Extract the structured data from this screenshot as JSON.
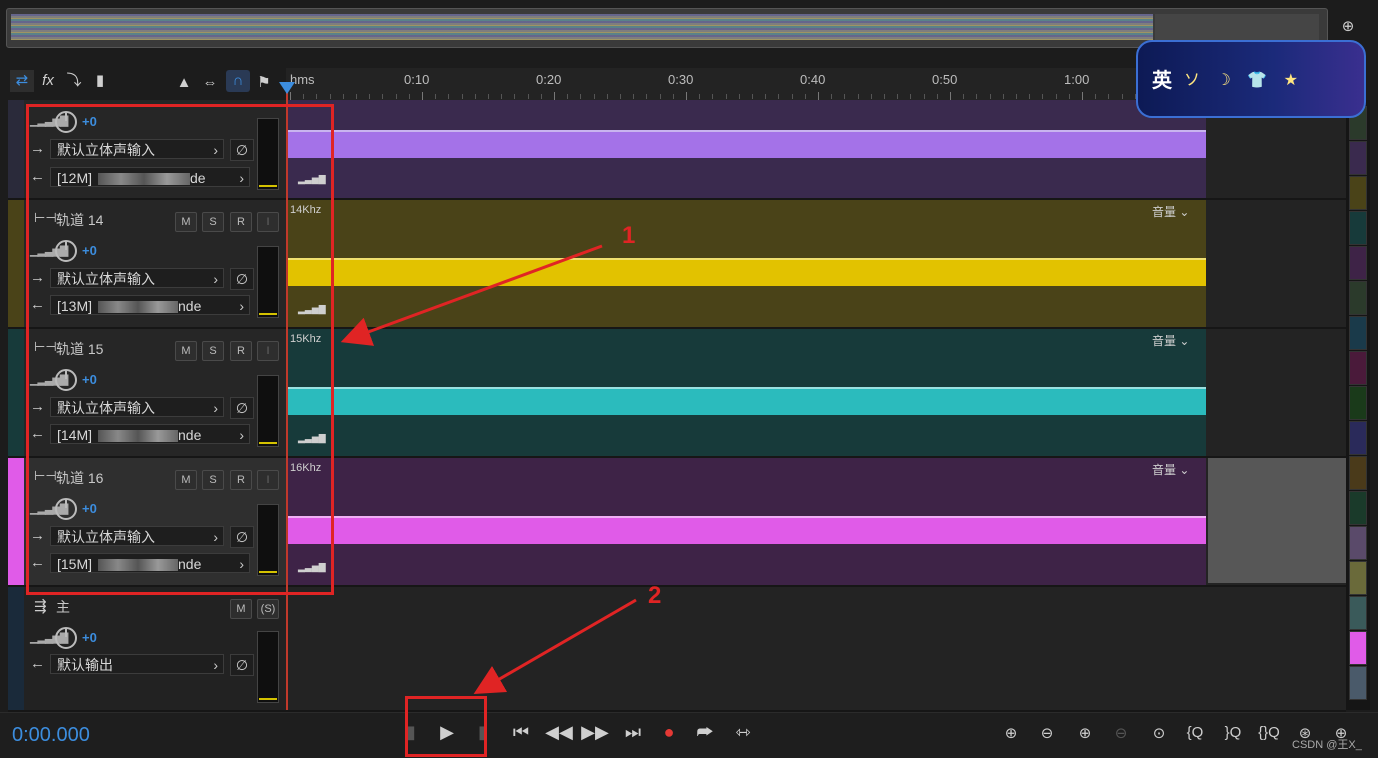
{
  "overview": {},
  "toolbar_left": {
    "icons": [
      "swap-icon",
      "fx-icon",
      "send-icon",
      "eq-bars-icon"
    ],
    "fx_label": "fx"
  },
  "toolbar_mid": {
    "icons": [
      "metronome-icon",
      "punch-icon",
      "snap-magnet-icon",
      "marker-icon"
    ]
  },
  "ruler": {
    "labels": [
      "hms",
      "0:10",
      "0:20",
      "0:30",
      "0:40",
      "0:50",
      "1:00"
    ]
  },
  "tracks": [
    {
      "name": "",
      "volume": "+0",
      "input": "默认立体声输入",
      "output": "[12M]",
      "output_tail": "de",
      "color": "#a472e8",
      "lane_bg": "#3a2a4e",
      "khz": "",
      "vol_selector": ""
    },
    {
      "name": "轨道 14",
      "volume": "+0",
      "input": "默认立体声输入",
      "output": "[13M]",
      "output_tail": "nde",
      "color": "#e2c200",
      "lane_bg": "#4a4318",
      "khz": "14Khz",
      "vol_selector": "音量"
    },
    {
      "name": "轨道 15",
      "volume": "+0",
      "input": "默认立体声输入",
      "output": "[14M]",
      "output_tail": "nde",
      "color": "#2bbbbd",
      "lane_bg": "#173a3a",
      "khz": "15Khz",
      "vol_selector": "音量"
    },
    {
      "name": "轨道 16",
      "volume": "+0",
      "input": "默认立体声输入",
      "output": "[15M]",
      "output_tail": "nde",
      "color": "#e05be8",
      "lane_bg": "#3e2347",
      "khz": "16Khz",
      "vol_selector": "音量"
    }
  ],
  "master": {
    "name": "主",
    "volume": "+0",
    "output": "默认输出"
  },
  "buttons": {
    "m": "M",
    "s": "S",
    "r": "R",
    "i": "I",
    "s_master": "(S)"
  },
  "transport": {
    "timecode": "0:00.000"
  },
  "annotations": {
    "label1": "1",
    "label2": "2"
  },
  "ime": {
    "char": "英",
    "deco": "ソ ☽ 👕 ★"
  },
  "watermark": "CSDN @王X_",
  "swatch_colors": [
    "#2b3a2b",
    "#3a2a4e",
    "#4a4318",
    "#173a3a",
    "#3e2347",
    "#2b3a2b",
    "#1a3a4a",
    "#4a1a3a",
    "#1a3a1a",
    "#2a2a5a",
    "#4a3a1a",
    "#1a3a2a",
    "#5a4a6a",
    "#6a6a3a",
    "#3a5a5a",
    "#e05be8",
    "#4a5a6a"
  ]
}
